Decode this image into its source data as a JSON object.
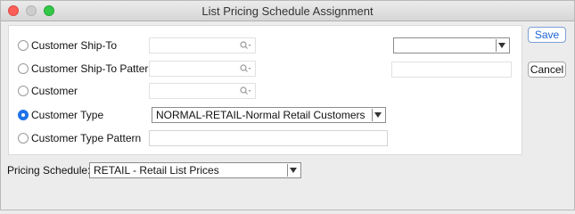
{
  "window": {
    "title": "List Pricing Schedule Assignment"
  },
  "options": [
    {
      "label": "Customer Ship-To",
      "selected": false
    },
    {
      "label": "Customer Ship-To Pattern",
      "selected": false
    },
    {
      "label": "Customer",
      "selected": false
    },
    {
      "label": "Customer Type",
      "selected": true
    },
    {
      "label": "Customer Type Pattern",
      "selected": false
    }
  ],
  "customer_type_select": {
    "value": "NORMAL-RETAIL-Normal Retail Customers"
  },
  "right_select": {
    "value": ""
  },
  "buttons": {
    "save": "Save",
    "cancel": "Cancel"
  },
  "pricing_schedule": {
    "label": "Pricing Schedule:",
    "value": "RETAIL - Retail List Prices"
  },
  "icons": {
    "lookup": "magnifier-dropdown-icon",
    "dropdown": "chevron-down-icon"
  },
  "colors": {
    "accent": "#1e72e8",
    "close": "#fc5f57",
    "zoom": "#33c748"
  }
}
